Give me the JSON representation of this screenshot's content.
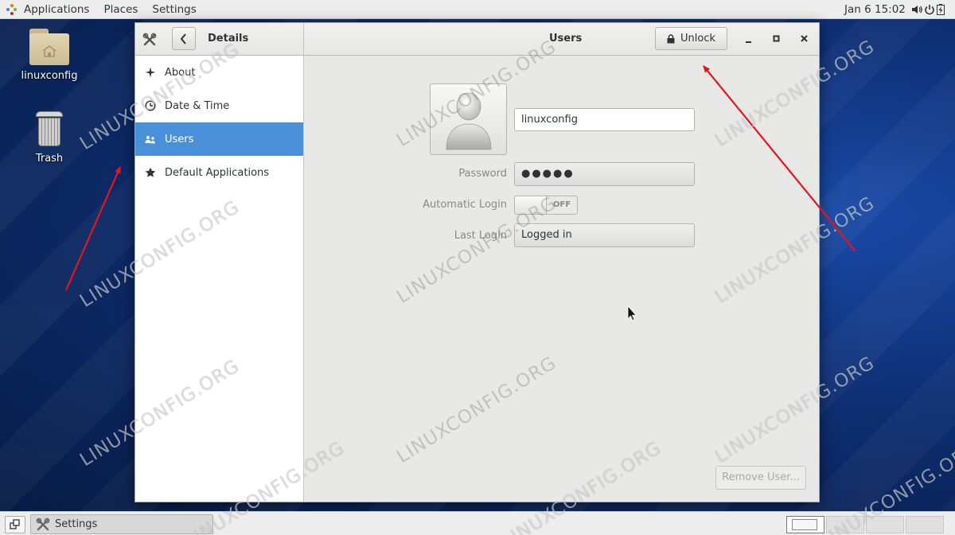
{
  "topbar": {
    "applications": "Applications",
    "places": "Places",
    "settings": "Settings",
    "clock": "Jan 6  15:02",
    "tray_icons": [
      "volume-icon",
      "power-icon",
      "battery-icon"
    ]
  },
  "desktop": {
    "icons": [
      {
        "label": "linuxconfig",
        "icon": "home-folder-icon"
      },
      {
        "label": "Trash",
        "icon": "trash-icon"
      }
    ]
  },
  "window": {
    "sidebar_title": "Details",
    "content_title": "Users",
    "unlock_label": "Unlock",
    "sidebar_items": [
      {
        "label": "About",
        "icon": "star-outline-icon",
        "selected": false
      },
      {
        "label": "Date & Time",
        "icon": "clock-icon",
        "selected": false
      },
      {
        "label": "Users",
        "icon": "users-icon",
        "selected": true
      },
      {
        "label": "Default Applications",
        "icon": "star-icon",
        "selected": false
      }
    ],
    "user": {
      "username": "linuxconfig",
      "password_label": "Password",
      "password_value": "●●●●●",
      "autologin_label": "Automatic Login",
      "autologin_state": "OFF",
      "last_login_label": "Last Login",
      "last_login_value": "Logged in"
    },
    "remove_user_label": "Remove User..."
  },
  "taskbar": {
    "task_label": "Settings",
    "workspaces": 4,
    "active_workspace": 1
  },
  "watermark": "LINUXCONFIG.ORG",
  "colors": {
    "selection": "#4a90d9",
    "annotation_arrow": "#e8141c",
    "desktop": "#0e2f73"
  }
}
